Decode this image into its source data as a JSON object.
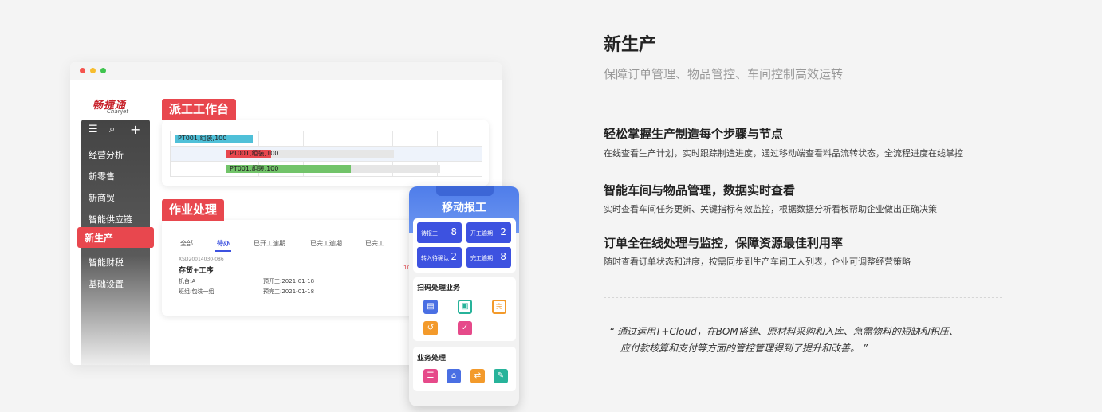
{
  "mockup": {
    "brand": {
      "name_cn": "畅捷通",
      "name_en": "Chanjet"
    },
    "sidebar": {
      "items": [
        "经营分析",
        "新零售",
        "新商贸",
        "智能供应链",
        "新生产",
        "智能财税",
        "基础设置"
      ],
      "active": "新生产"
    },
    "dispatch": {
      "title": "派工工作台",
      "bars": [
        {
          "label": "PT001,组装,100",
          "color": "#4fc0d8"
        },
        {
          "label": "PT001,组装,100",
          "color": "#e8474e"
        },
        {
          "label": "PT001,组装,100",
          "color": "#72c46a"
        }
      ]
    },
    "work": {
      "title": "作业处理",
      "tabs": [
        "全部",
        "待办",
        "已开工逾期",
        "已完工逾期",
        "已完工"
      ],
      "active_tab": "待办",
      "order_no": "XSD20014030-086",
      "item_title": "存货+工序",
      "qty_fragment": "10",
      "machine": "机台:A",
      "team": "班组:包装一组",
      "plan_start": "预开工:2021-01-18",
      "plan_end": "预完工:2021-01-18"
    },
    "mobile": {
      "title": "移动报工",
      "tiles": [
        {
          "label": "待报工",
          "value": "8"
        },
        {
          "label": "开工逾期",
          "value": "2"
        },
        {
          "label": "转入待确认",
          "value": "2"
        },
        {
          "label": "完工逾期",
          "value": "8"
        }
      ],
      "scan_title": "扫码处理业务",
      "scan_icons": [
        "list-scan-icon",
        "scan-frame-icon",
        "scan-complete-icon",
        "scan-refresh-icon",
        "scan-check-icon"
      ],
      "biz_title": "业务处理",
      "biz_icons": [
        "checklist-icon",
        "warehouse-icon",
        "transfer-icon",
        "document-icon"
      ]
    }
  },
  "content": {
    "title": "新生产",
    "subtitle": "保障订单管理、物品管控、车间控制高效运转",
    "features": [
      {
        "heading": "轻松掌握生产制造每个步骤与节点",
        "text": "在线查看生产计划，实时跟踪制造进度，通过移动端查看料品流转状态，全流程进度在线掌控"
      },
      {
        "heading": "智能车间与物品管理，数据实时查看",
        "text": "实时查看车间任务更新、关键指标有效监控，根据数据分析看板帮助企业做出正确决策"
      },
      {
        "heading": "订单全在线处理与监控，保障资源最佳利用率",
        "text": "随时查看订单状态和进度，按需同步到生产车间工人列表，企业可调整经营策略"
      }
    ],
    "quote_line1": "“ 通过运用T+Cloud，在BOM搭建、原材料采购和入库、急需物料的短缺和积压、",
    "quote_line2": "应付款核算和支付等方面的管控管理得到了提升和改善。 ”"
  },
  "colors": {
    "accent_red": "#e8474e",
    "mobile_blue": "#3d52e0"
  }
}
